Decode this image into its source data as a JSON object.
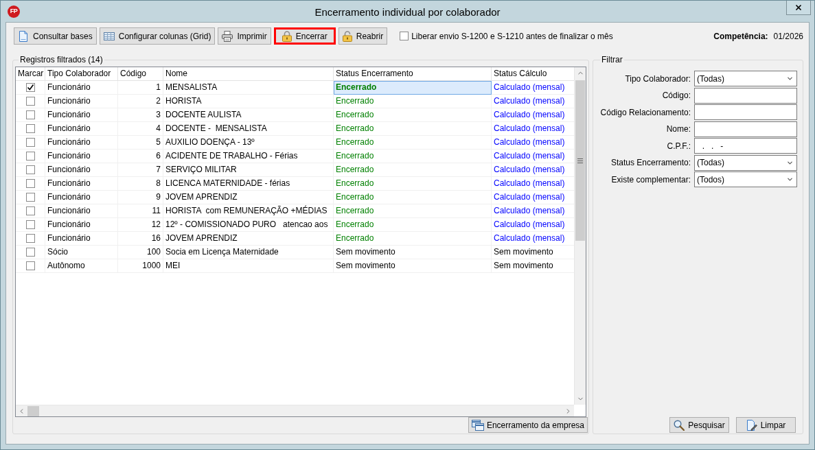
{
  "window": {
    "logo": "FP",
    "title": "Encerramento individual por colaborador"
  },
  "toolbar": {
    "buttons": [
      {
        "label": "Consultar bases",
        "highlighted": false
      },
      {
        "label": "Configurar colunas (Grid)",
        "highlighted": false
      },
      {
        "label": "Imprimir",
        "highlighted": false
      },
      {
        "label": "Encerrar",
        "highlighted": true
      },
      {
        "label": "Reabrir",
        "highlighted": false
      }
    ],
    "release_option": {
      "label": "Liberar envio S-1200 e S-1210 antes de finalizar o mês",
      "checked": false
    },
    "competencia": {
      "label": "Competência:",
      "value": "01/2026"
    }
  },
  "records": {
    "title": "Registros filtrados (14)",
    "columns": [
      "Marcar",
      "Tipo Colaborador",
      "Código",
      "Nome",
      "Status Encerramento",
      "Status Cálculo"
    ],
    "rows": [
      {
        "checked": true,
        "selected": true,
        "tipo": "Funcionário",
        "codigo": "1",
        "nome": "MENSALISTA",
        "status_encerramento": {
          "text": "Encerrado",
          "color": "#008000"
        },
        "status_calculo": {
          "text": "Calculado (mensal)",
          "color": "#0000ff"
        }
      },
      {
        "checked": false,
        "selected": false,
        "tipo": "Funcionário",
        "codigo": "2",
        "nome": "HORISTA",
        "status_encerramento": {
          "text": "Encerrado",
          "color": "#008000"
        },
        "status_calculo": {
          "text": "Calculado (mensal)",
          "color": "#0000ff"
        }
      },
      {
        "checked": false,
        "selected": false,
        "tipo": "Funcionário",
        "codigo": "3",
        "nome": "DOCENTE AULISTA",
        "status_encerramento": {
          "text": "Encerrado",
          "color": "#008000"
        },
        "status_calculo": {
          "text": "Calculado (mensal)",
          "color": "#0000ff"
        }
      },
      {
        "checked": false,
        "selected": false,
        "tipo": "Funcionário",
        "codigo": "4",
        "nome": "DOCENTE -  MENSALISTA",
        "status_encerramento": {
          "text": "Encerrado",
          "color": "#008000"
        },
        "status_calculo": {
          "text": "Calculado (mensal)",
          "color": "#0000ff"
        }
      },
      {
        "checked": false,
        "selected": false,
        "tipo": "Funcionário",
        "codigo": "5",
        "nome": "AUXILIO DOENÇA - 13º",
        "status_encerramento": {
          "text": "Encerrado",
          "color": "#008000"
        },
        "status_calculo": {
          "text": "Calculado (mensal)",
          "color": "#0000ff"
        }
      },
      {
        "checked": false,
        "selected": false,
        "tipo": "Funcionário",
        "codigo": "6",
        "nome": "ACIDENTE DE TRABALHO - Férias",
        "status_encerramento": {
          "text": "Encerrado",
          "color": "#008000"
        },
        "status_calculo": {
          "text": "Calculado (mensal)",
          "color": "#0000ff"
        }
      },
      {
        "checked": false,
        "selected": false,
        "tipo": "Funcionário",
        "codigo": "7",
        "nome": "SERVIÇO MILITAR",
        "status_encerramento": {
          "text": "Encerrado",
          "color": "#008000"
        },
        "status_calculo": {
          "text": "Calculado (mensal)",
          "color": "#0000ff"
        }
      },
      {
        "checked": false,
        "selected": false,
        "tipo": "Funcionário",
        "codigo": "8",
        "nome": "LICENCA MATERNIDADE - férias",
        "status_encerramento": {
          "text": "Encerrado",
          "color": "#008000"
        },
        "status_calculo": {
          "text": "Calculado (mensal)",
          "color": "#0000ff"
        }
      },
      {
        "checked": false,
        "selected": false,
        "tipo": "Funcionário",
        "codigo": "9",
        "nome": "JOVEM APRENDIZ",
        "status_encerramento": {
          "text": "Encerrado",
          "color": "#008000"
        },
        "status_calculo": {
          "text": "Calculado (mensal)",
          "color": "#0000ff"
        }
      },
      {
        "checked": false,
        "selected": false,
        "tipo": "Funcionário",
        "codigo": "11",
        "nome": "HORISTA  com REMUNERAÇÃO +MÉDIAS",
        "status_encerramento": {
          "text": "Encerrado",
          "color": "#008000"
        },
        "status_calculo": {
          "text": "Calculado (mensal)",
          "color": "#0000ff"
        }
      },
      {
        "checked": false,
        "selected": false,
        "tipo": "Funcionário",
        "codigo": "12",
        "nome": "12º - COMISSIONADO PURO   atencao aos",
        "status_encerramento": {
          "text": "Encerrado",
          "color": "#008000"
        },
        "status_calculo": {
          "text": "Calculado (mensal)",
          "color": "#0000ff"
        }
      },
      {
        "checked": false,
        "selected": false,
        "tipo": "Funcionário",
        "codigo": "16",
        "nome": "JOVEM APRENDIZ",
        "status_encerramento": {
          "text": "Encerrado",
          "color": "#008000"
        },
        "status_calculo": {
          "text": "Calculado (mensal)",
          "color": "#0000ff"
        }
      },
      {
        "checked": false,
        "selected": false,
        "tipo": "Sócio",
        "codigo": "100",
        "nome": "Socia em Licença Maternidade",
        "status_encerramento": {
          "text": "Sem movimento",
          "color": "#000000"
        },
        "status_calculo": {
          "text": "Sem movimento",
          "color": "#000000"
        }
      },
      {
        "checked": false,
        "selected": false,
        "tipo": "Autônomo",
        "codigo": "1000",
        "nome": "MEI",
        "status_encerramento": {
          "text": "Sem movimento",
          "color": "#000000"
        },
        "status_calculo": {
          "text": "Sem movimento",
          "color": "#000000"
        }
      }
    ],
    "company_button": {
      "label": "Encerramento da empresa"
    }
  },
  "filter": {
    "title": "Filtrar",
    "fields": [
      {
        "label": "Tipo Colaborador:",
        "kind": "select",
        "value": "(Todas)"
      },
      {
        "label": "Código:",
        "kind": "text"
      },
      {
        "label": "Código Relacionamento:",
        "kind": "text"
      },
      {
        "label": "Nome:",
        "kind": "text"
      },
      {
        "label": "C.P.F.:",
        "kind": "text",
        "value": "  .   .   -"
      },
      {
        "label": "Status Encerramento:",
        "kind": "select",
        "value": "(Todas)"
      },
      {
        "label": "Existe complementar:",
        "kind": "select",
        "value": "(Todos)"
      }
    ],
    "buttons": [
      {
        "label": "Pesquisar"
      },
      {
        "label": "Limpar"
      }
    ]
  }
}
